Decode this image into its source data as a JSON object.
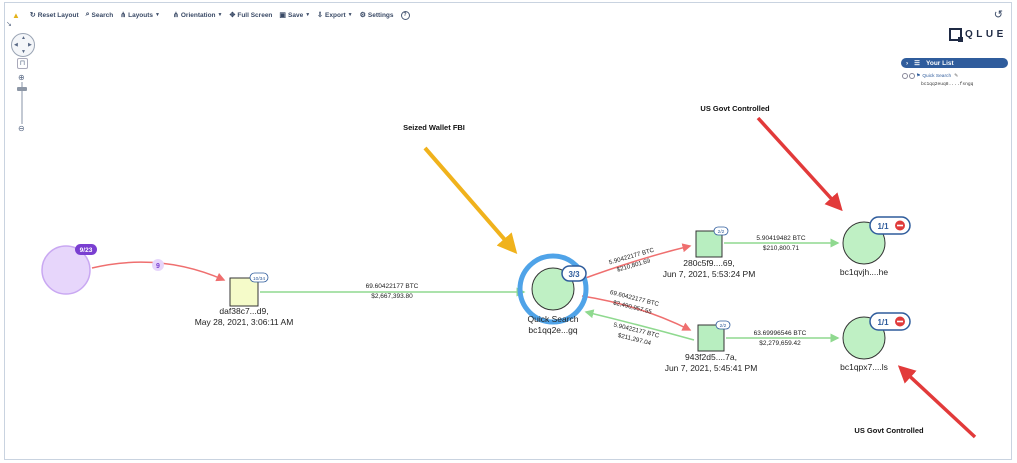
{
  "toolbar": {
    "reset_layout": "Reset Layout",
    "search": "Search",
    "layouts": "Layouts",
    "orientation": "Orientation",
    "full_screen": "Full Screen",
    "save": "Save",
    "export": "Export",
    "settings": "Settings"
  },
  "panel": {
    "logo": "QLUE",
    "your_list": "Your List",
    "list_item_label": "Quick Search",
    "list_item_addr": "bc1qq2euq8....fsngq"
  },
  "annotations": {
    "seized": "Seized Wallet FBI",
    "us_top": "US Govt Controlled",
    "us_bottom": "US Govt Controlled"
  },
  "nodes": {
    "source_badge": "9/23",
    "edge_count": "9",
    "daf_badge": "10/34",
    "daf_label": "daf38c7...d9,",
    "daf_date": "May 28, 2021, 3:06:11 AM",
    "qs_badge": "3/3",
    "qs_name": "Quick Search",
    "qs_addr": "bc1qq2e...gq",
    "n280_badge": "2/2",
    "n280_label": "280c5f9....69,",
    "n280_date": "Jun 7, 2021, 5:53:24 PM",
    "n943_badge": "2/2",
    "n943_label": "943f2d5....7a,",
    "n943_date": "Jun 7, 2021, 5:45:41 PM",
    "t1_badge": "1/1",
    "t1_label": "bc1qvjh....he",
    "t2_badge": "1/1",
    "t2_label": "bc1qpx7....ls"
  },
  "edges": {
    "e1_btc": "69.60422177 BTC",
    "e1_usd": "$2,667,393.80",
    "e2_btc": "5.90422177 BTC",
    "e2_usd": "$210,801.69",
    "e3_btc": "69.60422177 BTC",
    "e3_usd": "$2,490,957.55",
    "e4_btc": "5.90422177 BTC",
    "e4_usd": "$211,297.04",
    "e5_btc": "5.90419482 BTC",
    "e5_usd": "$210,800.71",
    "e6_btc": "63.69996546 BTC",
    "e6_usd": "$2,279,659.42"
  },
  "colors": {
    "green_edge": "#8fd98f",
    "red_edge": "#ef6f6f",
    "tx_fill": "#b8eec0",
    "node_fill": "#bff0c4",
    "blue_ring": "#4fa3e8",
    "arrow_orange": "#f0b21c",
    "arrow_red": "#e23a3a",
    "badge_blue": "#2f5c9c",
    "badge_purple": "#7a3fd1"
  }
}
